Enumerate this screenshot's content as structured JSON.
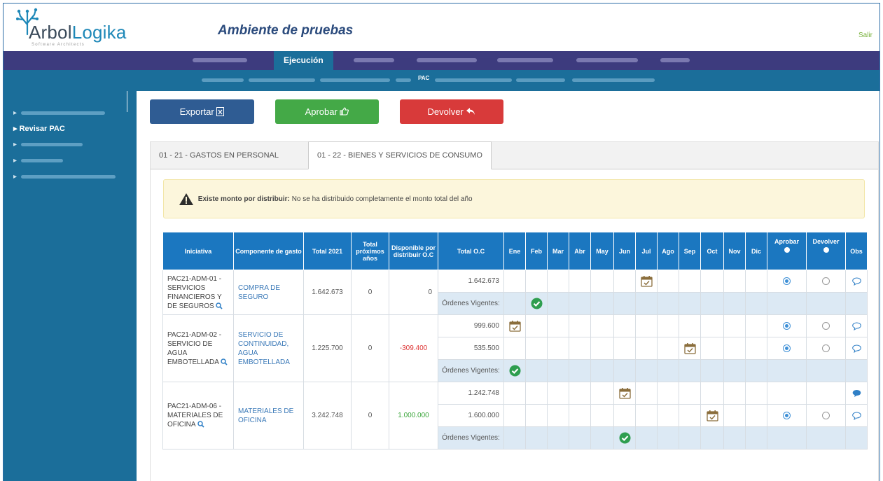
{
  "header": {
    "logo_text_1": "Arbol",
    "logo_text_2": "Logika",
    "logo_tagline": "Software Architects",
    "environment_title": "Ambiente de pruebas",
    "logout": "Salir"
  },
  "main_nav": {
    "active": "Ejecución"
  },
  "sub_nav": {
    "active": "PAC"
  },
  "sidebar": {
    "active": "Revisar PAC"
  },
  "toolbar": {
    "export": "Exportar",
    "approve": "Aprobar",
    "return": "Devolver"
  },
  "tabs": [
    {
      "label": "01 - 21 - GASTOS EN PERSONAL",
      "active": false
    },
    {
      "label": "01 - 22 - BIENES Y SERVICIOS DE CONSUMO",
      "active": true
    }
  ],
  "alert": {
    "title": "Existe monto por distribuir:",
    "message": "No se ha distribuido completamente el monto total del año"
  },
  "table": {
    "headers": [
      "Iniciativa",
      "Componente de gasto",
      "Total 2021",
      "Total próximos años",
      "Disponible por distribuir O.C",
      "Total O.C",
      "Ene",
      "Feb",
      "Mar",
      "Abr",
      "May",
      "Jun",
      "Jul",
      "Ago",
      "Sep",
      "Oct",
      "Nov",
      "Dic",
      "Aprobar",
      "Devolver",
      "Obs"
    ],
    "ordenes_label": "Órdenes Vigentes:",
    "groups": [
      {
        "initiative": "PAC21-ADM-01 - SERVICIOS FINANCIEROS Y DE SEGUROS",
        "component": "COMPRA DE SEGURO",
        "total_2021": "1.642.673",
        "total_next": "0",
        "available": "0",
        "oc_rows": [
          {
            "total_oc": "1.642.673",
            "month": "Jul",
            "approve": true,
            "obs_filled": false
          }
        ],
        "ordenes_month": "Feb"
      },
      {
        "initiative": "PAC21-ADM-02 - SERVICIO DE AGUA EMBOTELLADA",
        "component": "SERVICIO DE CONTINUIDAD, AGUA EMBOTELLADA",
        "total_2021": "1.225.700",
        "total_next": "0",
        "available": "-309.400",
        "oc_rows": [
          {
            "total_oc": "999.600",
            "month": "Ene",
            "approve": true,
            "obs_filled": false
          },
          {
            "total_oc": "535.500",
            "month": "Sep",
            "approve": true,
            "obs_filled": false
          }
        ],
        "ordenes_month": "Ene"
      },
      {
        "initiative": "PAC21-ADM-06 - MATERIALES DE OFICINA",
        "component": "MATERIALES DE OFICINA",
        "total_2021": "3.242.748",
        "total_next": "0",
        "available": "1.000.000",
        "oc_rows": [
          {
            "total_oc": "1.242.748",
            "month": "Jun",
            "approve": null,
            "obs_filled": true
          },
          {
            "total_oc": "1.600.000",
            "month": "Oct",
            "approve": true,
            "obs_filled": false
          }
        ],
        "ordenes_month": "Jun"
      }
    ]
  }
}
